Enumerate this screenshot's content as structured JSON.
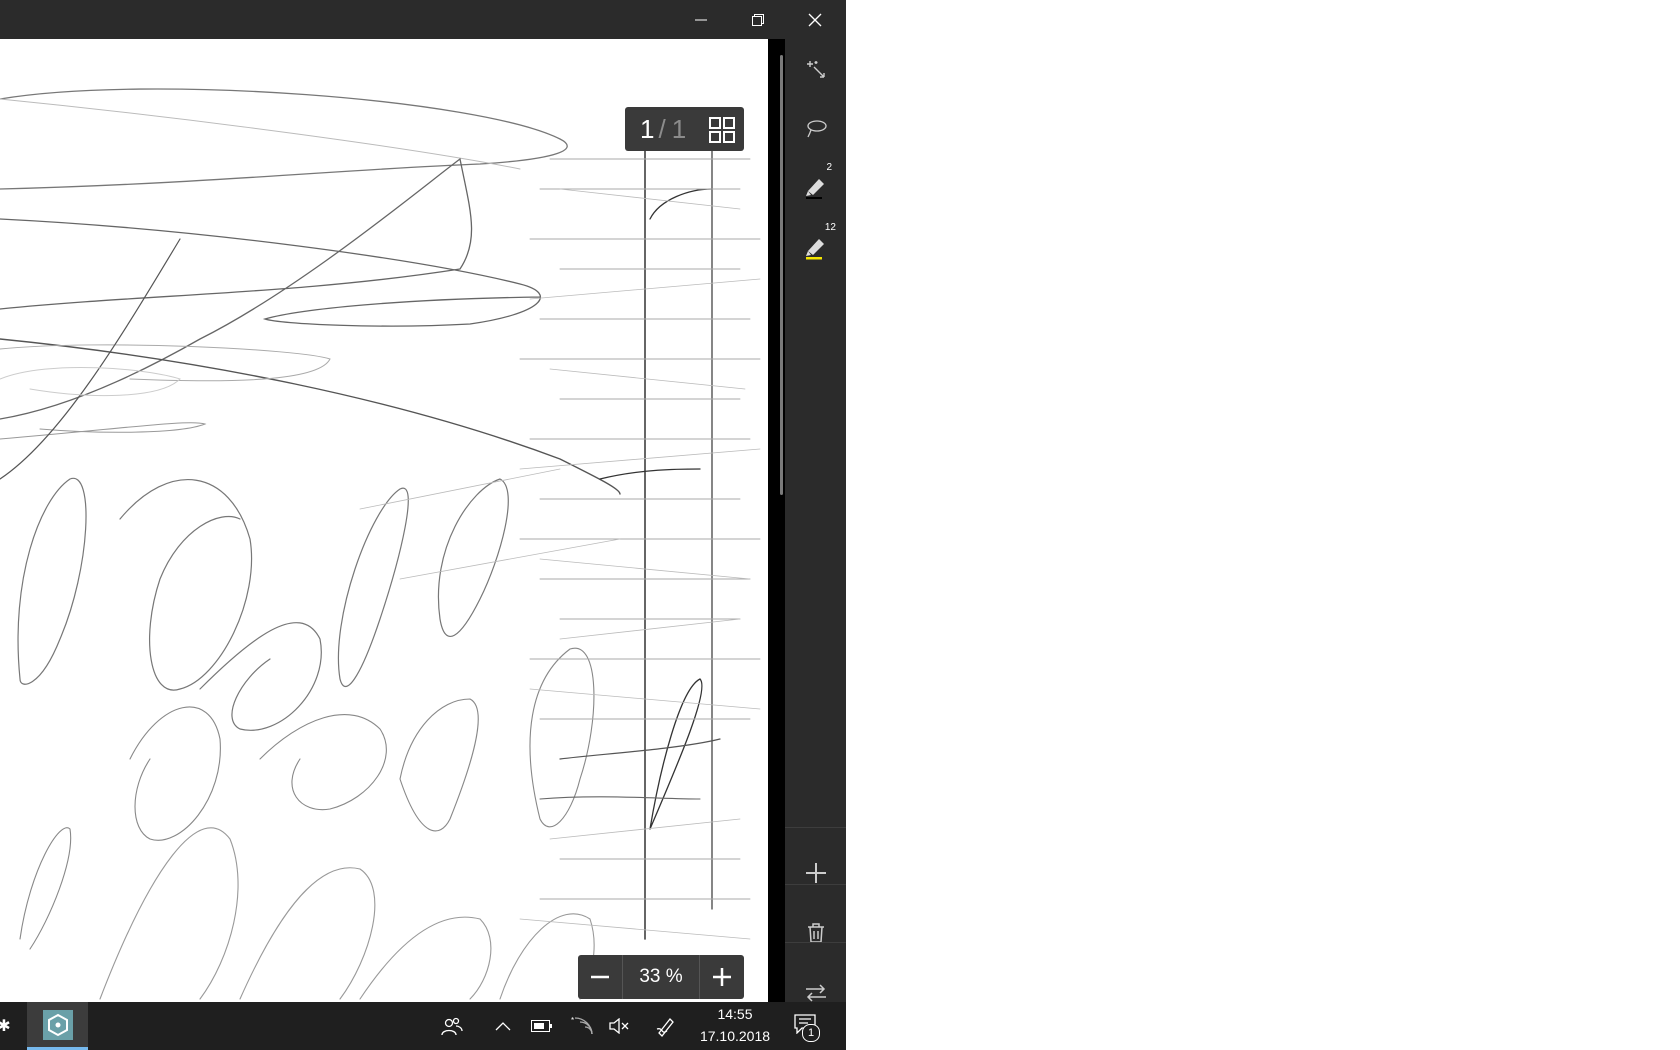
{
  "window": {
    "controls": {
      "minimize_icon": "minimize-icon",
      "restore_icon": "restore-icon",
      "close_icon": "close-icon"
    }
  },
  "canvas": {
    "page_counter": {
      "current": "1",
      "separator": "/",
      "total": "1",
      "grid_icon": "grid-view-icon"
    },
    "zoom": {
      "value": "33 %",
      "minus_icon": "minus-icon",
      "plus_icon": "plus-icon"
    }
  },
  "toolbar": {
    "tools": [
      {
        "name": "select-tool",
        "icon": "sparkle-cursor-icon"
      },
      {
        "name": "lasso-tool",
        "icon": "lasso-icon"
      },
      {
        "name": "pen-tool",
        "icon": "pen-icon",
        "badge": "2",
        "color": "#000000"
      },
      {
        "name": "highlighter-tool",
        "icon": "highlighter-icon",
        "badge": "12",
        "color": "#f5e600"
      }
    ],
    "actions": [
      {
        "name": "add-page",
        "icon": "plus-icon"
      },
      {
        "name": "delete",
        "icon": "trash-icon"
      },
      {
        "name": "swap",
        "icon": "swap-arrows-icon"
      }
    ]
  },
  "taskbar": {
    "time": "14:55",
    "date": "17.10.2018",
    "notification_count": "1",
    "tray_icons": [
      "people-icon",
      "chevron-up-icon",
      "battery-icon",
      "wifi-icon",
      "speaker-muted-icon",
      "pen-icon"
    ]
  },
  "colors": {
    "titlebar": "#2b2b2b",
    "toolbar": "#2b2b2b",
    "taskbar": "#1f1f1f",
    "accent": "#76b9ed"
  }
}
